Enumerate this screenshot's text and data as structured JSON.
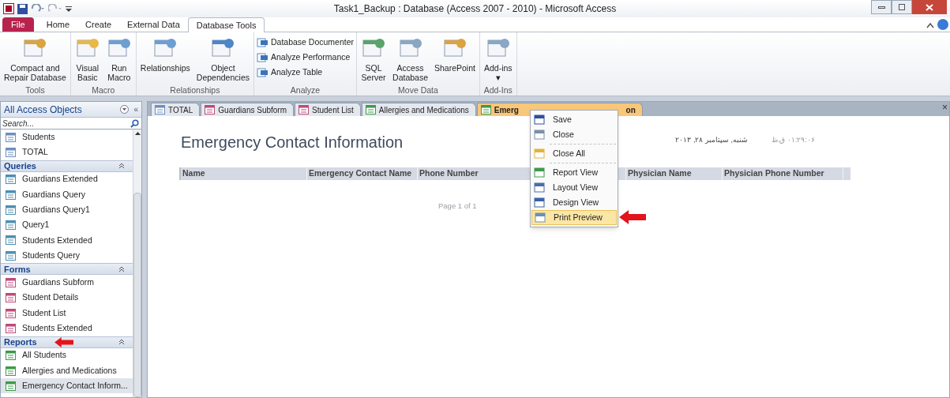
{
  "window": {
    "title": "Task1_Backup : Database (Access 2007 - 2010)  -  Microsoft Access"
  },
  "ribbon_tabs": [
    {
      "label": "File",
      "kind": "file",
      "selected": false
    },
    {
      "label": "Home",
      "kind": "tab",
      "selected": false
    },
    {
      "label": "Create",
      "kind": "tab",
      "selected": false
    },
    {
      "label": "External Data",
      "kind": "tab",
      "selected": false
    },
    {
      "label": "Database Tools",
      "kind": "tab",
      "selected": true
    }
  ],
  "ribbon_groups": [
    {
      "name": "Tools",
      "items": [
        {
          "kind": "large",
          "label": "Compact and\nRepair Database"
        }
      ]
    },
    {
      "name": "Macro",
      "items": [
        {
          "kind": "large",
          "label": "Visual\nBasic"
        },
        {
          "kind": "large",
          "label": "Run\nMacro"
        }
      ]
    },
    {
      "name": "Relationships",
      "items": [
        {
          "kind": "large",
          "label": "Relationships"
        },
        {
          "kind": "large",
          "label": "Object\nDependencies"
        }
      ]
    },
    {
      "name": "Analyze",
      "items": [
        {
          "kind": "small",
          "label": "Database Documenter"
        },
        {
          "kind": "small",
          "label": "Analyze Performance"
        },
        {
          "kind": "small",
          "label": "Analyze Table"
        }
      ]
    },
    {
      "name": "Move Data",
      "items": [
        {
          "kind": "large",
          "label": "SQL\nServer"
        },
        {
          "kind": "large",
          "label": "Access\nDatabase"
        },
        {
          "kind": "large",
          "label": "SharePoint"
        }
      ]
    },
    {
      "name": "Add-Ins",
      "items": [
        {
          "kind": "large",
          "label": "Add-ins\n▾"
        }
      ]
    }
  ],
  "nav": {
    "title": "All Access Objects",
    "collapse": "«",
    "search": {
      "placeholder": "Search..."
    },
    "groups": [
      {
        "expanded": true,
        "pointed": false,
        "items": [
          {
            "label": "Students",
            "kind": "table",
            "selected": false
          },
          {
            "label": "TOTAL",
            "kind": "table",
            "selected": false
          }
        ]
      },
      {
        "title": "Queries",
        "expanded": true,
        "pointed": false,
        "items": [
          {
            "label": "Guardians Extended",
            "kind": "query",
            "selected": false
          },
          {
            "label": "Guardians Query",
            "kind": "query",
            "selected": false
          },
          {
            "label": "Guardians Query1",
            "kind": "query",
            "selected": false
          },
          {
            "label": "Query1",
            "kind": "query",
            "selected": false
          },
          {
            "label": "Students Extended",
            "kind": "query",
            "selected": false
          },
          {
            "label": "Students Query",
            "kind": "query",
            "selected": false
          }
        ]
      },
      {
        "title": "Forms",
        "expanded": true,
        "pointed": false,
        "items": [
          {
            "label": "Guardians Subform",
            "kind": "form",
            "selected": false
          },
          {
            "label": "Student Details",
            "kind": "form",
            "selected": false
          },
          {
            "label": "Student List",
            "kind": "form",
            "selected": false
          },
          {
            "label": "Students Extended",
            "kind": "form",
            "selected": false
          }
        ]
      },
      {
        "title": "Reports",
        "expanded": true,
        "pointed": true,
        "items": [
          {
            "label": "All Students",
            "kind": "report",
            "selected": false
          },
          {
            "label": "Allergies and Medications",
            "kind": "report",
            "selected": false
          },
          {
            "label": "Emergency Contact Inform...",
            "kind": "report",
            "selected": true
          }
        ]
      }
    ]
  },
  "doc_tabs": [
    {
      "label": "TOTAL",
      "kind": "table",
      "selected": false
    },
    {
      "label": "Guardians Subform",
      "kind": "form",
      "selected": false
    },
    {
      "label": "Student List",
      "kind": "form",
      "selected": false
    },
    {
      "label": "Allergies and Medications",
      "kind": "report",
      "selected": false
    },
    {
      "label": "Emerg",
      "label_end": "on",
      "kind": "report",
      "selected": true
    }
  ],
  "doc_close": "×",
  "report": {
    "title": "Emergency Contact Information",
    "date": "شنبه, سپتامبر ۲۸, ۲۰۱۳",
    "time": "۰۱:۲۹:۰۶ ق.ظ",
    "columns": [
      "Name",
      "Emergency Contact Name",
      "Phone Number",
      "Physician Name",
      "Physician Phone Number"
    ],
    "footer": "Page 1 of 1"
  },
  "context_menu": [
    {
      "label": "Save",
      "selected": false,
      "pointed": false
    },
    {
      "label": "Close",
      "selected": false,
      "pointed": false
    },
    {
      "label": "Close All",
      "selected": false,
      "pointed": false
    },
    {
      "label": "Report View",
      "selected": false,
      "pointed": false
    },
    {
      "label": "Layout View",
      "selected": false,
      "pointed": false
    },
    {
      "label": "Design View",
      "selected": false,
      "pointed": false
    },
    {
      "label": "Print Preview",
      "selected": true,
      "pointed": true
    }
  ]
}
